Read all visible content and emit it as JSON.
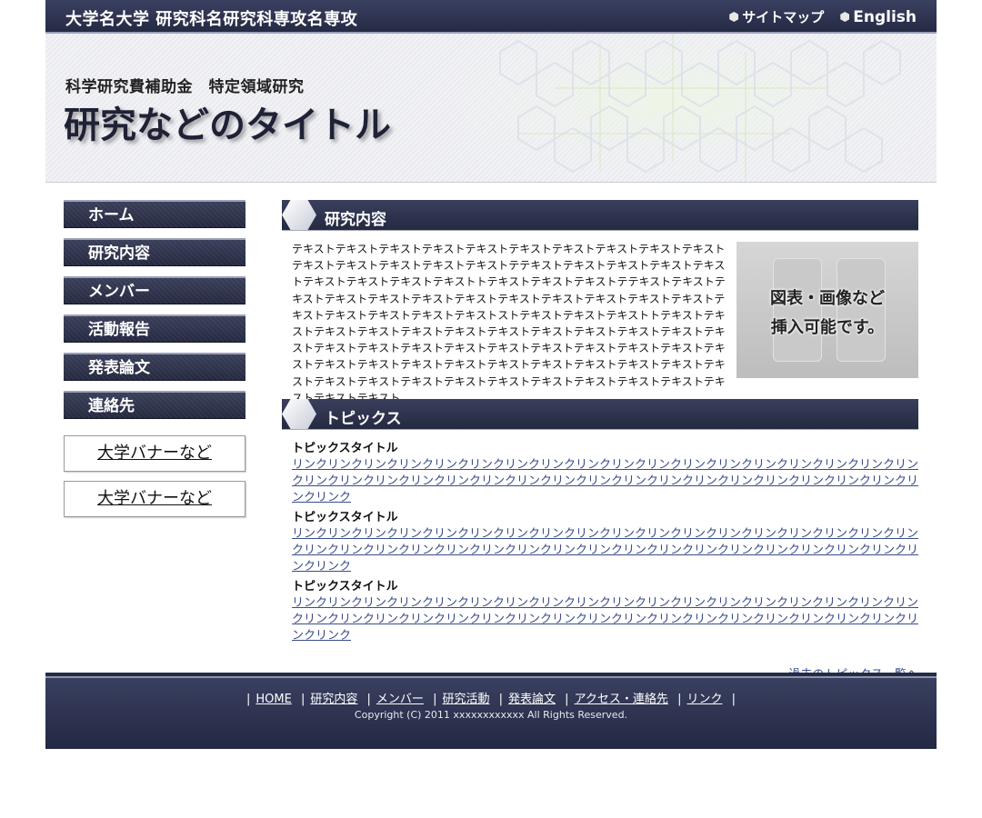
{
  "topbar": {
    "site_name": "大学名大学 研究科名研究科専攻名専攻",
    "sitemap": "サイトマップ",
    "english": "English"
  },
  "header": {
    "subtitle": "科学研究費補助金　特定領域研究",
    "title": "研究などのタイトル"
  },
  "sidebar": {
    "nav": [
      "ホーム",
      "研究内容",
      "メンバー",
      "活動報告",
      "発表論文",
      "連絡先"
    ],
    "banners": [
      "大学バナーなど",
      "大学バナーなど"
    ]
  },
  "research": {
    "heading": "研究内容",
    "text": "テキストテキストテキストテキストテキストテキストテキストテキストテキストテキストテキストテキストテキストテキストテキストテテキストテキストテキストテキストテキストテキストテキストテキストテキストトテキストテキストテキストテテキストテキストテキストテキストテキストテキストテキストテキストテキストテキストテキストテキストテキストテキストテキストテキストテキストストテキストテキストテキストトテキストテキストテキストテキストテキストテキストテキストテキストテキストテキストテキストテキストテキストテキストテキストテキストテキストテキストテキストテキストテキストテキストテキストテキストテキストテキストテキストテキストテキストテキストテキストテキストテキストテキストテキストテキストテキストテキストテキストテキストテキストテキストテキストテキスト",
    "figure_line1": "図表・画像など",
    "figure_line2": "挿入可能です。"
  },
  "topics": {
    "heading": "トピックス",
    "items": [
      {
        "title": "トピックスタイトル",
        "link": "リンクリンクリンクリンクリンクリンクリンクリンクリンクリンクリンクリンクリンクリンクリンクリンクリンクリンクリンクリンクリンクリンクリンクリンクリンクリンクリンクリンクリンクリンクリンクリンクリンクリンクリンクリンクリンク"
      },
      {
        "title": "トピックスタイトル",
        "link": "リンクリンクリンクリンクリンクリンクリンクリンクリンクリンクリンクリンクリンクリンクリンクリンクリンクリンクリンクリンクリンクリンクリンクリンクリンクリンクリンクリンクリンクリンクリンクリンクリンクリンクリンクリンクリンク"
      },
      {
        "title": "トピックスタイトル",
        "link": "リンクリンクリンクリンクリンクリンクリンクリンクリンクリンクリンクリンクリンクリンクリンクリンクリンクリンクリンクリンクリンクリンクリンクリンクリンクリンクリンクリンクリンクリンクリンクリンクリンクリンクリンクリンクリンク"
      }
    ],
    "more": "過去のトピックス一覧へ"
  },
  "footer": {
    "nav": [
      "HOME",
      "研究内容",
      "メンバー",
      "研究活動",
      "発表論文",
      "アクセス・連絡先",
      "リンク"
    ],
    "copyright": "Copyright (C) 2011 xxxxxxxxxxxx All Rights Reserved."
  },
  "colors": {
    "dark_navy": "#262b45",
    "link_blue": "#3b4d8a"
  }
}
